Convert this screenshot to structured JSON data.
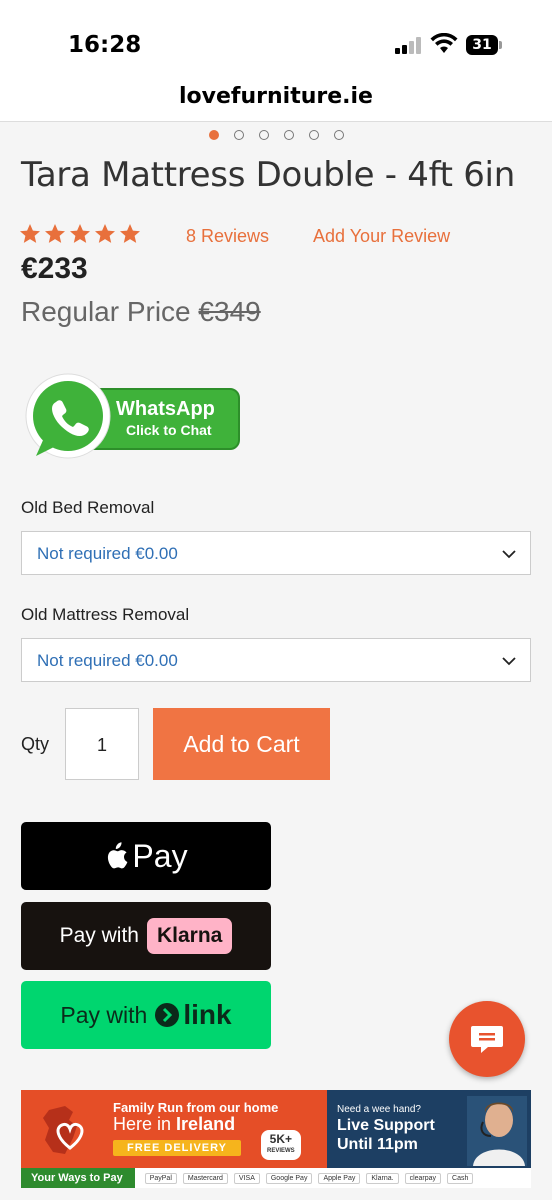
{
  "status_bar": {
    "time": "16:28",
    "battery": "31"
  },
  "browser": {
    "url": "lovefurniture.ie"
  },
  "carousel": {
    "dot_count": 6,
    "active_index": 0
  },
  "product": {
    "title": "Tara Mattress Double - 4ft 6in",
    "rating_stars": 5,
    "reviews_link": "8 Reviews",
    "add_review_link": "Add Your Review",
    "price": "€233",
    "regular_price_label": "Regular Price",
    "regular_price": "€349"
  },
  "whatsapp": {
    "title": "WhatsApp",
    "subtitle": "Click to Chat"
  },
  "options": {
    "bed_removal": {
      "label": "Old Bed Removal",
      "value": "Not required €0.00"
    },
    "mattress_removal": {
      "label": "Old Mattress Removal",
      "value": "Not required €0.00"
    }
  },
  "cart": {
    "qty_label": "Qty",
    "qty_value": "1",
    "add_label": "Add to Cart"
  },
  "payments": {
    "apple_pay": "Pay",
    "klarna_prefix": "Pay with",
    "klarna_brand": "Klarna",
    "link_prefix": "Pay with",
    "link_brand": "link"
  },
  "banner": {
    "family_run": "Family Run from our home",
    "here_in": "Here in",
    "ireland": "Ireland",
    "free_delivery": "FREE DELIVERY",
    "reviews_badge": "5K+",
    "reviews_badge_sub": "REVIEWS",
    "need_hand": "Need a wee hand?",
    "live_support": "Live Support",
    "until": "Until 11pm",
    "ways_to_pay": "Your Ways to Pay",
    "pay_logos": [
      "PayPal",
      "Mastercard",
      "VISA",
      "Google Pay",
      "Apple Pay",
      "Klarna.",
      "clearpay",
      "Cash"
    ]
  },
  "colors": {
    "accent": "#e8703c",
    "select_text": "#2f6fb5",
    "add_to_cart": "#f07443",
    "whatsapp_green": "#3fb23a",
    "link_green": "#00d66f",
    "klarna_pink": "#ffb3c7",
    "chat_fab": "#e8532e"
  }
}
